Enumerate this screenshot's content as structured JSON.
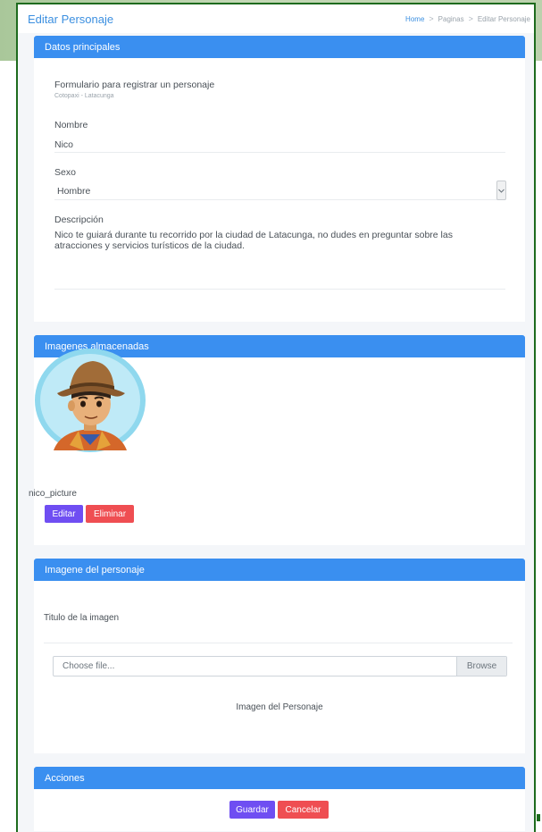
{
  "header": {
    "title": "Editar Personaje",
    "breadcrumb": [
      "Home",
      "Paginas",
      "Editar Personaje"
    ]
  },
  "datos": {
    "header": "Datos principales",
    "form_title": "Formulario para registrar un personaje",
    "form_subtitle": "Cotopaxi - Latacunga",
    "nombre_label": "Nombre",
    "nombre_value": "Nico",
    "sexo_label": "Sexo",
    "sexo_value": "Hombre",
    "descripcion_label": "Descripción",
    "descripcion_value": "Nico te guiará durante tu recorrido por la ciudad de Latacunga, no dudes en preguntar sobre las atracciones y servicios turísticos de la ciudad."
  },
  "imagenes": {
    "header": "Imagenes almacenadas",
    "image_name": "nico_picture",
    "edit_label": "Editar",
    "delete_label": "Eliminar"
  },
  "imagen_personaje": {
    "header": "Imagene del personaje",
    "titulo_label": "Titulo de la imagen",
    "file_placeholder": "Choose file...",
    "browse_label": "Browse",
    "imagen_label": "Imagen del Personaje"
  },
  "acciones": {
    "header": "Acciones",
    "save_label": "Guardar",
    "cancel_label": "Cancelar"
  },
  "colors": {
    "accent": "#3a8ff0",
    "purple": "#6f4ef2",
    "red": "#ef4e52",
    "frame": "#1e6b1e"
  }
}
